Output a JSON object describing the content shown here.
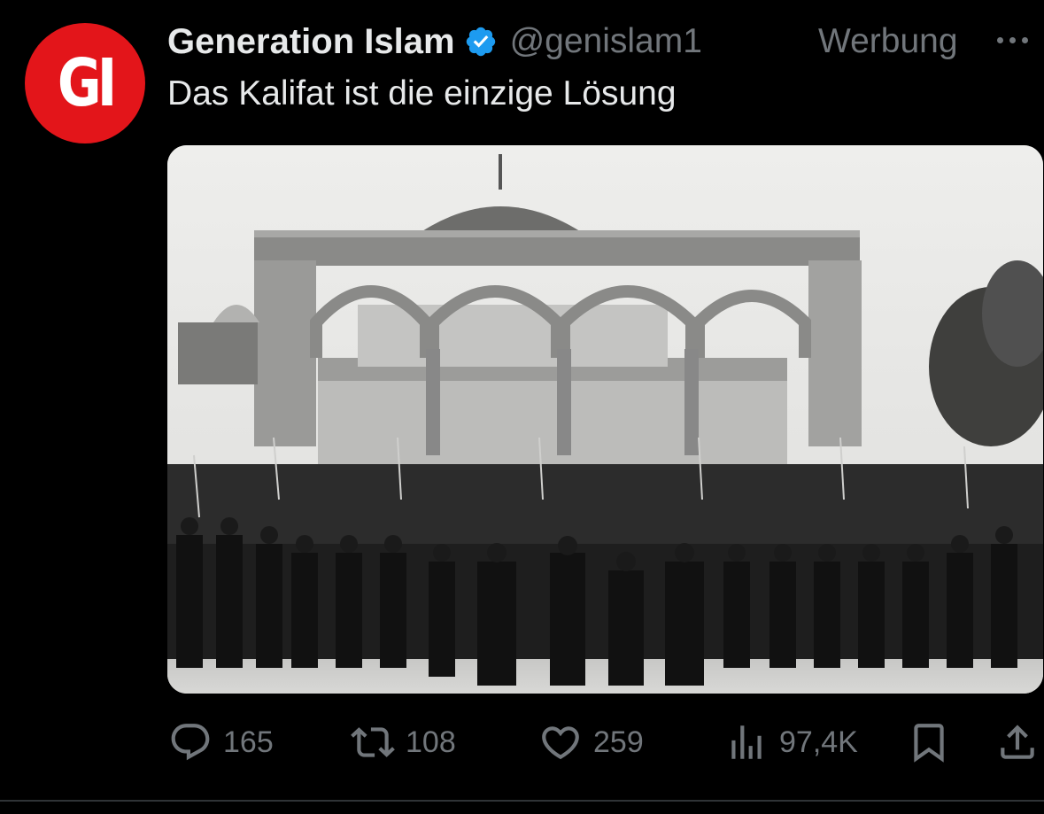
{
  "author": {
    "avatar_text": "GI",
    "name": "Generation Islam",
    "handle": "@genislam1",
    "ad_label": "Werbung",
    "verified_icon": "verified-badge-icon"
  },
  "tweet": {
    "text": "Das Kalifat ist die einzige Lösung"
  },
  "actions": {
    "replies": "165",
    "retweets": "108",
    "likes": "259",
    "views": "97,4K"
  },
  "colors": {
    "background": "#000000",
    "text": "#e7e9ea",
    "muted": "#71767b",
    "verified": "#1d9bf0",
    "avatar": "#e3151a"
  }
}
